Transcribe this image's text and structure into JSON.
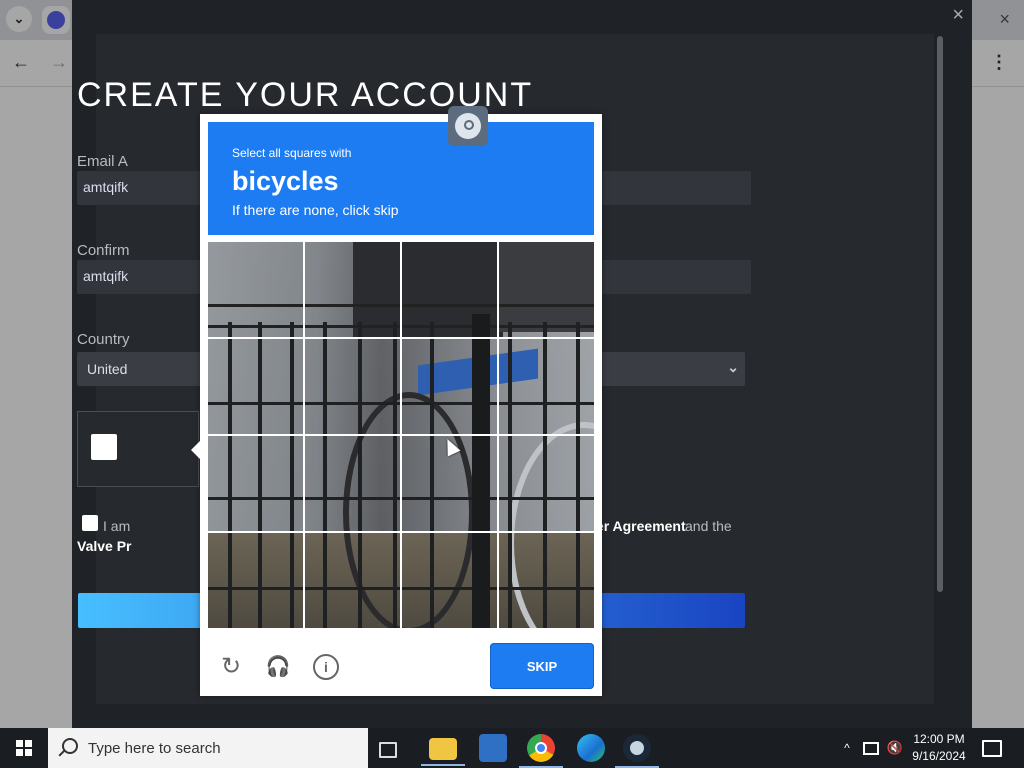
{
  "browser": {
    "back_icon": "arrow-left",
    "forward_icon": "arrow-right",
    "close_icon": "×",
    "menu_icon": "⋮"
  },
  "steam": {
    "title": "CREATE YOUR ACCOUNT",
    "email_label": "Email A",
    "email_value": "amtqifk",
    "confirm_label": "Confirm",
    "confirm_value": "amtqifk",
    "country_label": "Country",
    "country_value": "United",
    "agree_text": "I am",
    "agree_link": "Subscriber Agreement",
    "agree_rest": "and the",
    "agree_link2": "Valve Pr",
    "close_icon": "×",
    "dropdown_icon": "⌄"
  },
  "captcha": {
    "prompt": "Select all squares with",
    "keyword": "bicycles",
    "hint": "If there are none, click skip",
    "skip_label": "SKIP",
    "refresh_icon": "↻",
    "audio_icon": "🎧",
    "info_icon": "i",
    "badge_icon": "steam-logo"
  },
  "taskbar": {
    "search_placeholder": "Type here to search",
    "time": "12:00 PM",
    "date": "9/16/2024",
    "tray_up_icon": "^",
    "volume_icon": "🔇",
    "pinned": [
      "task-view",
      "file-explorer",
      "microsoft-store",
      "chrome",
      "edge",
      "steam"
    ]
  },
  "colors": {
    "captcha_blue": "#1e7cf2",
    "steam_bg": "#26292e",
    "taskbar_bg": "#1a1d22"
  }
}
